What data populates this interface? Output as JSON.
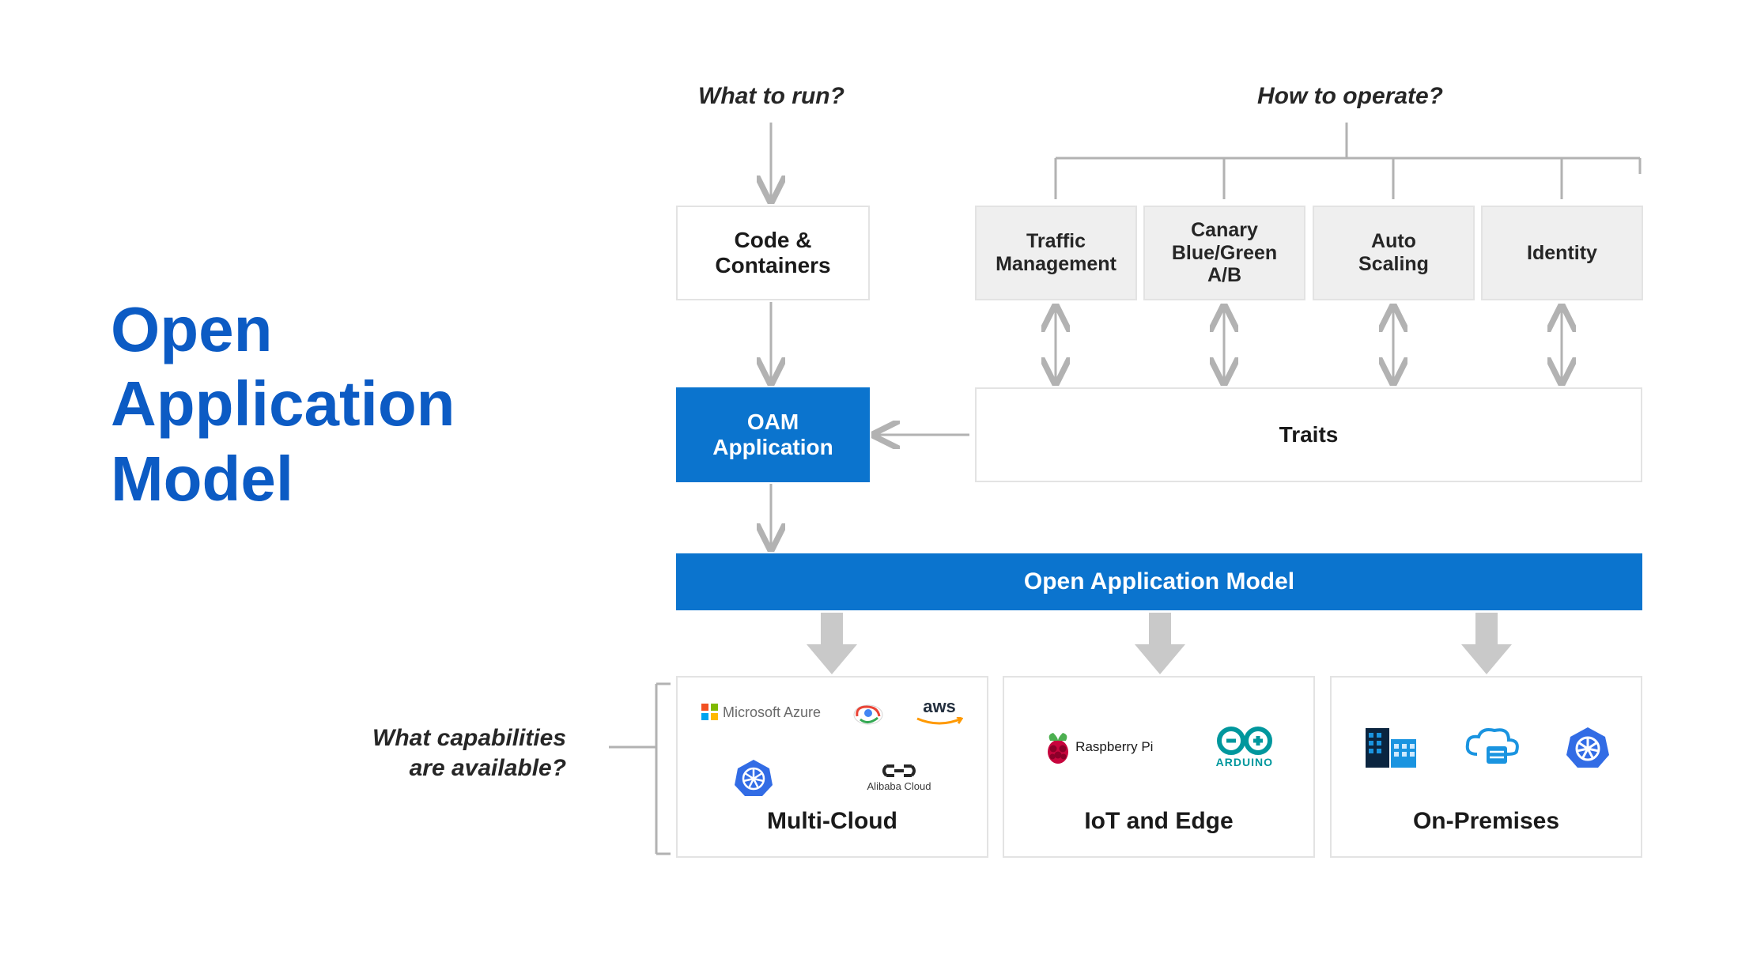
{
  "title": "Open\nApplication\nModel",
  "questions": {
    "what_to_run": "What to run?",
    "how_to_operate": "How to operate?",
    "capabilities": "What capabilities\nare available?"
  },
  "boxes": {
    "code_containers": "Code &\nContainers",
    "oam_application": "OAM\nApplication",
    "traits": "Traits",
    "oam_bar": "Open Application Model"
  },
  "trait_items": [
    "Traffic\nManagement",
    "Canary\nBlue/Green\nA/B",
    "Auto\nScaling",
    "Identity"
  ],
  "deploy_targets": {
    "multi_cloud": "Multi-Cloud",
    "iot_edge": "IoT and Edge",
    "on_prem": "On-Premises"
  },
  "cloud_logos": [
    "Microsoft Azure",
    "Google Cloud",
    "aws",
    "Kubernetes",
    "Alibaba Cloud"
  ],
  "iot_logos": [
    "Raspberry Pi",
    "ARDUINO"
  ],
  "onprem_logos": [
    "Datacenter",
    "Cloud-Server",
    "Kubernetes"
  ],
  "colors": {
    "blue": "#0b74ce",
    "title_blue": "#0c5bc4",
    "arrow": "#b2b2b2",
    "thick_arrow": "#c9c9c9"
  }
}
